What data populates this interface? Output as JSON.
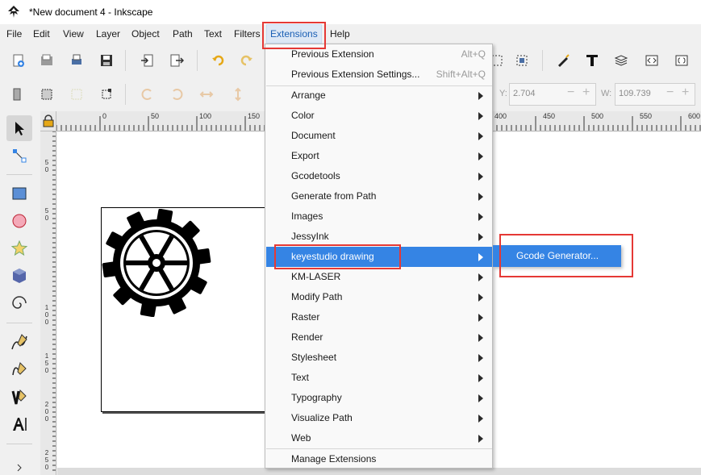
{
  "window": {
    "title": "*New document 4 - Inkscape"
  },
  "menubar": {
    "items": [
      "File",
      "Edit",
      "View",
      "Layer",
      "Object",
      "Path",
      "Text",
      "Filters",
      "Extensions",
      "Help"
    ],
    "active": "Extensions"
  },
  "toolbar": {
    "y_label": "Y:",
    "y_value": "2.704",
    "w_label": "W:",
    "w_value": "109.739",
    "plus_symbol": "+",
    "minus_symbol": "−"
  },
  "ruler": {
    "h_labels": [
      "0",
      "50",
      "100",
      "150",
      "400",
      "450",
      "500",
      "550",
      "600"
    ],
    "v_labels": [
      "5",
      "0",
      "5",
      "0",
      "1",
      "0",
      "0",
      "1",
      "5",
      "0",
      "2",
      "0",
      "0",
      "2",
      "5",
      "0"
    ]
  },
  "extensions_menu": {
    "items": [
      {
        "label": "Previous Extension",
        "shortcut": "Alt+Q"
      },
      {
        "label": "Previous Extension Settings...",
        "shortcut": "Shift+Alt+Q"
      },
      {
        "label": "Arrange",
        "submenu": true
      },
      {
        "label": "Color",
        "submenu": true
      },
      {
        "label": "Document",
        "submenu": true
      },
      {
        "label": "Export",
        "submenu": true
      },
      {
        "label": "Gcodetools",
        "submenu": true
      },
      {
        "label": "Generate from Path",
        "submenu": true
      },
      {
        "label": "Images",
        "submenu": true
      },
      {
        "label": "JessyInk",
        "submenu": true
      },
      {
        "label": "keyestudio drawing",
        "submenu": true,
        "highlighted": true
      },
      {
        "label": "KM-LASER",
        "submenu": true
      },
      {
        "label": "Modify Path",
        "submenu": true
      },
      {
        "label": "Raster",
        "submenu": true
      },
      {
        "label": "Render",
        "submenu": true
      },
      {
        "label": "Stylesheet",
        "submenu": true
      },
      {
        "label": "Text",
        "submenu": true
      },
      {
        "label": "Typography",
        "submenu": true
      },
      {
        "label": "Visualize Path",
        "submenu": true
      },
      {
        "label": "Web",
        "submenu": true
      },
      {
        "label": "Manage Extensions"
      }
    ]
  },
  "submenu": {
    "items": [
      "Gcode Generator..."
    ]
  },
  "colors": {
    "highlight": "#3584e4",
    "annotation_red": "#e53935"
  }
}
